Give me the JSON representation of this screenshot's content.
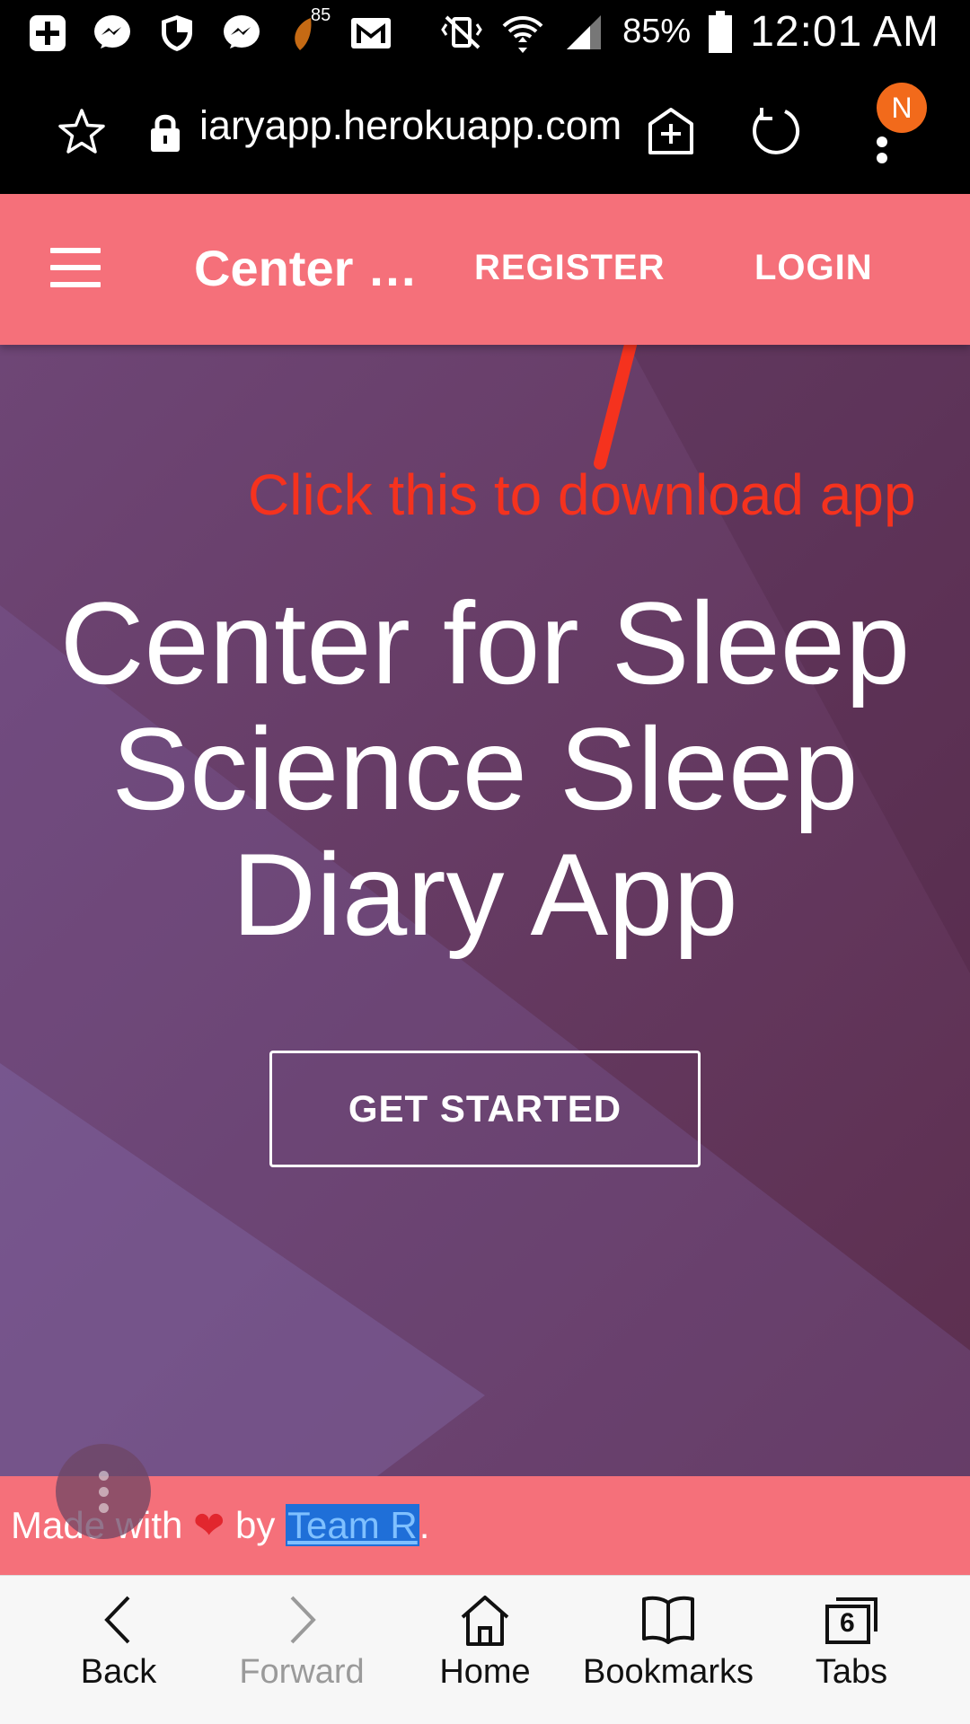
{
  "status_bar": {
    "notification_badge": "85",
    "battery": "85%",
    "time": "12:01 AM"
  },
  "url_bar": {
    "url": "iaryapp.herokuapp.com",
    "avatar_initial": "N"
  },
  "app_nav": {
    "brand": "Center …",
    "register": "REGISTER",
    "login": "LOGIN"
  },
  "annotation": "Click this to download app",
  "hero": {
    "title_line1": "Center for Sleep",
    "title_line2": "Science Sleep",
    "title_line3": "Diary App",
    "cta": "GET STARTED"
  },
  "footer": {
    "prefix": "Made with",
    "heart": "❤",
    "by": "by",
    "link": "Team R",
    "suffix": "."
  },
  "bottom_nav": {
    "back": "Back",
    "forward": "Forward",
    "home": "Home",
    "bookmarks": "Bookmarks",
    "tabs": "Tabs",
    "tab_count": "6"
  },
  "colors": {
    "accent": "#f5707a",
    "hero_dark": "#5c2e4e",
    "annotation": "#f5321e",
    "avatar": "#f26a1b"
  }
}
